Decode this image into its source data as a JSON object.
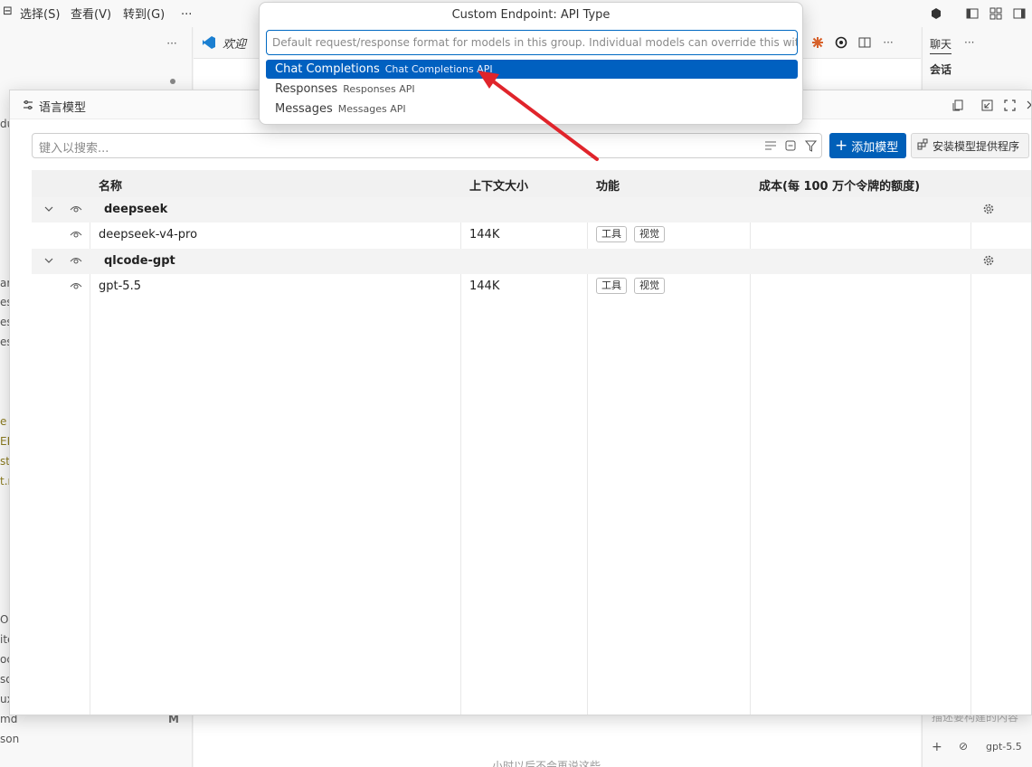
{
  "menu": {
    "selection": "选择(S)",
    "view": "查看(V)",
    "goto": "转到(G)",
    "more": "..."
  },
  "editor_tab": {
    "label": "欢迎"
  },
  "right_panel": {
    "title": "聊天",
    "subtitle": "会话",
    "model": "gpt-5.5",
    "hint": "描述要构建的内容"
  },
  "left_fragments": [
    "du",
    "ar",
    "es",
    "es",
    "es",
    "e",
    "EL",
    "st",
    "t.r",
    "O",
    "ite",
    "oc",
    "so",
    "ux",
    "md",
    "son"
  ],
  "left_badge": "M",
  "bottom_center_fragment": "小时以后不会再说这些",
  "modal": {
    "title": "语言模型",
    "search_placeholder": "键入以搜索...",
    "add_button": "添加模型",
    "install_button": "安装模型提供程序",
    "columns": {
      "name": "名称",
      "context": "上下文大小",
      "features": "功能",
      "cost": "成本(每 100 万个令牌的额度)"
    },
    "groups": [
      {
        "name": "deepseek",
        "models": [
          {
            "name": "deepseek-v4-pro",
            "context": "144K",
            "features": [
              "工具",
              "视觉"
            ]
          }
        ]
      },
      {
        "name": "qlcode-gpt",
        "models": [
          {
            "name": "gpt-5.5",
            "context": "144K",
            "features": [
              "工具",
              "视觉"
            ]
          }
        ]
      }
    ]
  },
  "quickpick": {
    "title": "Custom Endpoint: API Type",
    "placeholder": "Default request/response format for models in this group. Individual models can override this with th",
    "items": [
      {
        "label": "Chat Completions",
        "description": "Chat Completions API",
        "selected": true
      },
      {
        "label": "Responses",
        "description": "Responses API",
        "selected": false
      },
      {
        "label": "Messages",
        "description": "Messages API",
        "selected": false
      }
    ]
  },
  "colors": {
    "accent": "#005fb8",
    "selection": "#0060c0",
    "annotation_arrow": "#e0242b"
  }
}
